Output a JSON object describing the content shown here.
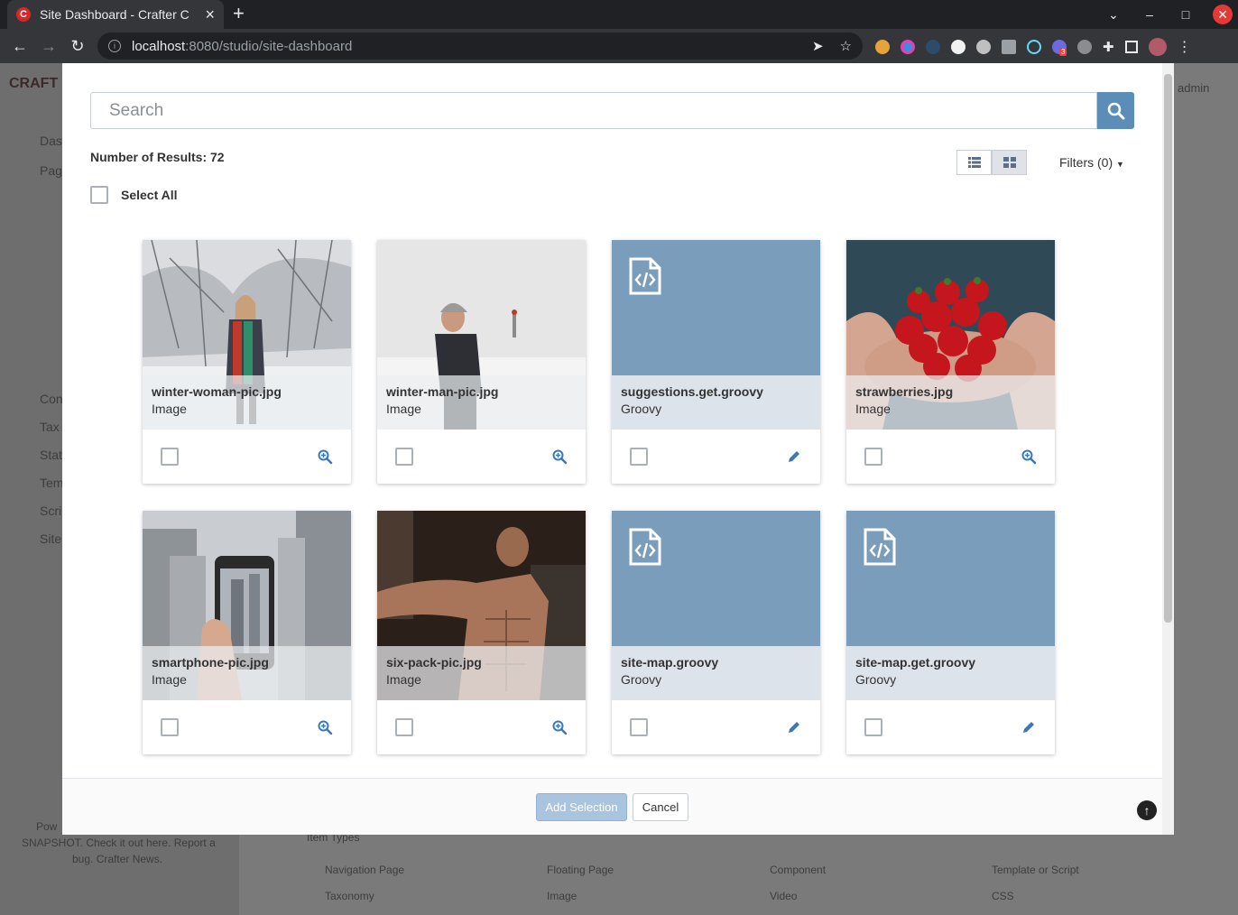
{
  "browser": {
    "tab_title": "Site Dashboard - Crafter C",
    "favicon_letter": "C",
    "new_tab": "+",
    "url_host": "localhost",
    "url_path": ":8080/studio/site-dashboard",
    "ext_badge": "3"
  },
  "background": {
    "logo": "CRAFT",
    "user": "admin",
    "nav_items": [
      "Das",
      "Pag",
      "Con",
      "Tax",
      "Stat",
      "Tem",
      "Scri",
      "Site"
    ],
    "footer_text_1": "Pow",
    "footer_text_2": "SNAPSHOT. Check it out here. Report a",
    "footer_text_3": "bug. Crafter News.",
    "item_types_label": "Item Types",
    "item_types": [
      "Navigation Page",
      "Floating Page",
      "Component",
      "Template or Script",
      "Taxonomy",
      "Image",
      "Video",
      "CSS"
    ]
  },
  "modal": {
    "search_placeholder": "Search",
    "results_label": "Number of Results",
    "results_count": ": 72",
    "filters_label": "Filters (0)",
    "select_all_label": "Select All",
    "add_selection_label": "Add Selection",
    "cancel_label": "Cancel",
    "items": [
      {
        "name": "winter-woman-pic.jpg",
        "type": "Image",
        "action": "zoom-icon"
      },
      {
        "name": "winter-man-pic.jpg",
        "type": "Image",
        "action": "zoom-icon"
      },
      {
        "name": "suggestions.get.groovy",
        "type": "Groovy",
        "action": "pencil-icon"
      },
      {
        "name": "strawberries.jpg",
        "type": "Image",
        "action": "zoom-icon"
      },
      {
        "name": "smartphone-pic.jpg",
        "type": "Image",
        "action": "zoom-icon"
      },
      {
        "name": "six-pack-pic.jpg",
        "type": "Image",
        "action": "zoom-icon"
      },
      {
        "name": "site-map.groovy",
        "type": "Groovy",
        "action": "pencil-icon"
      },
      {
        "name": "site-map.get.groovy",
        "type": "Groovy",
        "action": "pencil-icon"
      }
    ]
  }
}
